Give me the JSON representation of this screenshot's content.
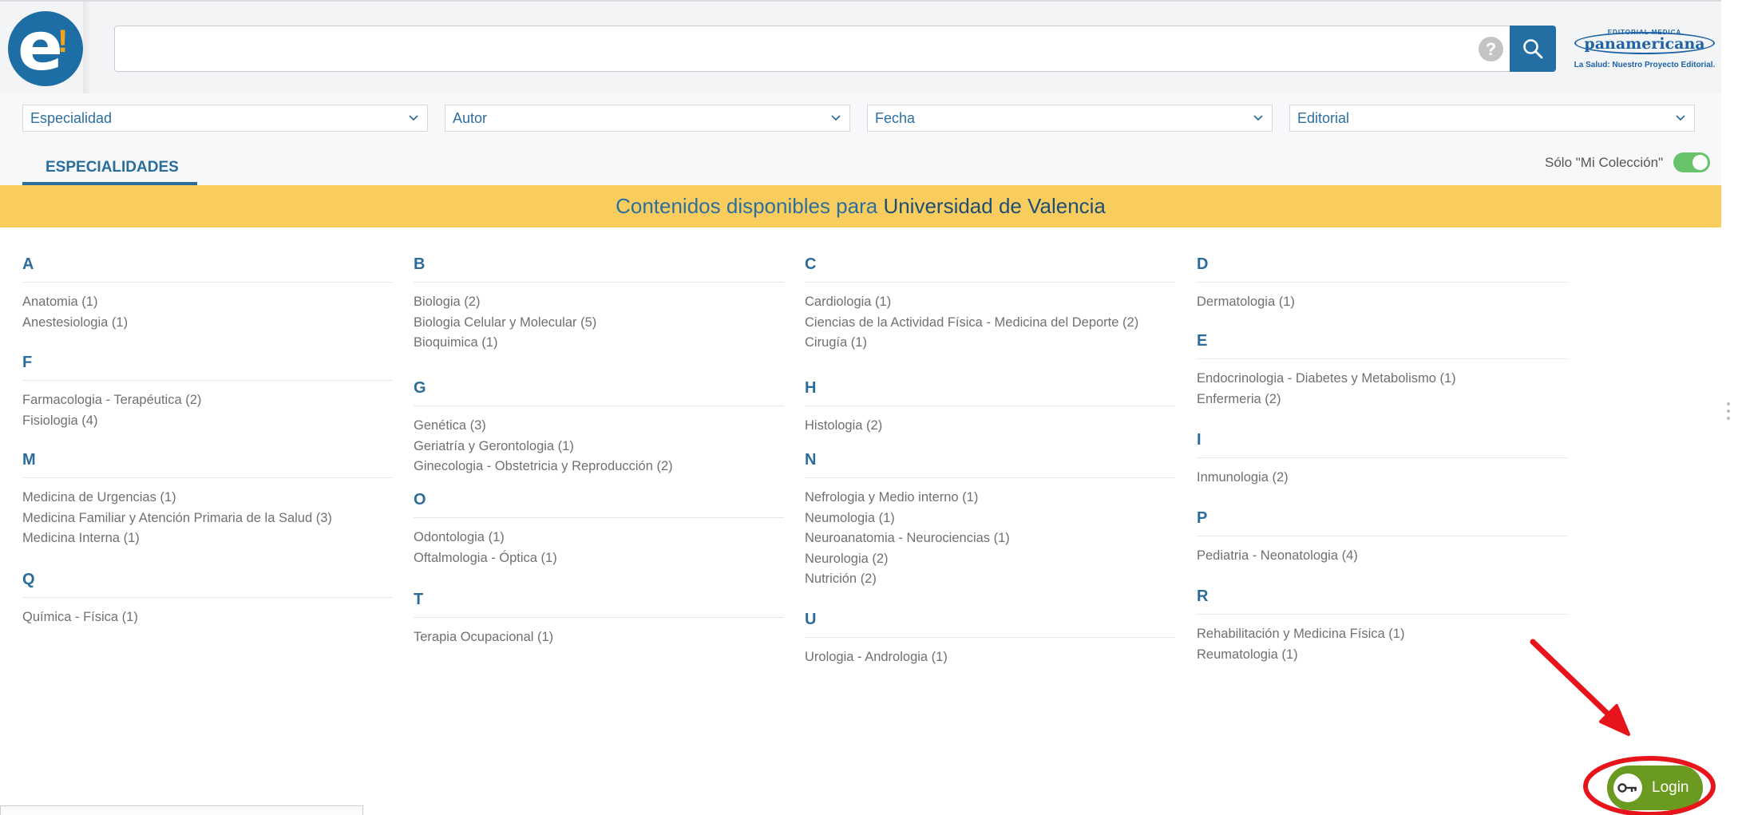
{
  "header": {
    "logo_letters": "e!",
    "search_value": "",
    "help_glyph": "?",
    "brand": {
      "top": "EDITORIAL MEDICA",
      "name": "panamericana",
      "tagline": "La Salud: Nuestro Proyecto Editorial."
    }
  },
  "filters": [
    {
      "label": "Especialidad"
    },
    {
      "label": "Autor"
    },
    {
      "label": "Fecha"
    },
    {
      "label": "Editorial"
    }
  ],
  "tabs": {
    "active": "ESPECIALIDADES"
  },
  "toggle": {
    "label": "Sólo \"Mi Colección\"",
    "on": true
  },
  "banner": {
    "prefix": "Contenidos disponibles para ",
    "institution": "Universidad de Valencia"
  },
  "groups": [
    {
      "letter": "A",
      "items": [
        "Anatomia (1)",
        "Anestesiologia (1)"
      ]
    },
    {
      "letter": "F",
      "items": [
        "Farmacologia - Terapéutica (2)",
        "Fisiologia (4)"
      ]
    },
    {
      "letter": "M",
      "items": [
        "Medicina de Urgencias (1)",
        "Medicina Familiar y Atención Primaria de la Salud (3)",
        "Medicina Interna (1)"
      ]
    },
    {
      "letter": "Q",
      "items": [
        "Química - Física (1)"
      ]
    },
    {
      "letter": "B",
      "items": [
        "Biologia (2)",
        "Biologia Celular y Molecular (5)",
        "Bioquimica (1)"
      ]
    },
    {
      "letter": "G",
      "items": [
        "Genética (3)",
        "Geriatría y Gerontologia (1)",
        "Ginecologia - Obstetricia y Reproducción (2)"
      ]
    },
    {
      "letter": "O",
      "items": [
        "Odontologia (1)",
        "Oftalmologia - Óptica (1)"
      ]
    },
    {
      "letter": "T",
      "items": [
        "Terapia Ocupacional (1)"
      ]
    },
    {
      "letter": "C",
      "items": [
        "Cardiologia (1)",
        "Ciencias de la Actividad Física - Medicina del Deporte (2)",
        "Cirugía (1)"
      ]
    },
    {
      "letter": "H",
      "items": [
        "Histologia (2)"
      ]
    },
    {
      "letter": "N",
      "items": [
        "Nefrologia y Medio interno (1)",
        "Neumologia (1)",
        "Neuroanatomia - Neurociencias (1)",
        "Neurologia (2)",
        "Nutrición (2)"
      ]
    },
    {
      "letter": "U",
      "items": [
        "Urologia - Andrologia (1)"
      ]
    },
    {
      "letter": "D",
      "items": [
        "Dermatologia (1)"
      ]
    },
    {
      "letter": "E",
      "items": [
        "Endocrinologia - Diabetes y Metabolismo (1)",
        "Enfermeria (2)"
      ]
    },
    {
      "letter": "I",
      "items": [
        "Inmunologia (2)"
      ]
    },
    {
      "letter": "P",
      "items": [
        "Pediatria - Neonatologia (4)"
      ]
    },
    {
      "letter": "R",
      "items": [
        "Rehabilitación y Medicina Física (1)",
        "Reumatologia (1)"
      ]
    }
  ],
  "login": {
    "label": "Login"
  },
  "colors": {
    "primary": "#236ea3",
    "banner": "#f9cd5d",
    "login": "#6a9a1f",
    "toggle": "#68c36a",
    "annotation": "#e8141b"
  }
}
